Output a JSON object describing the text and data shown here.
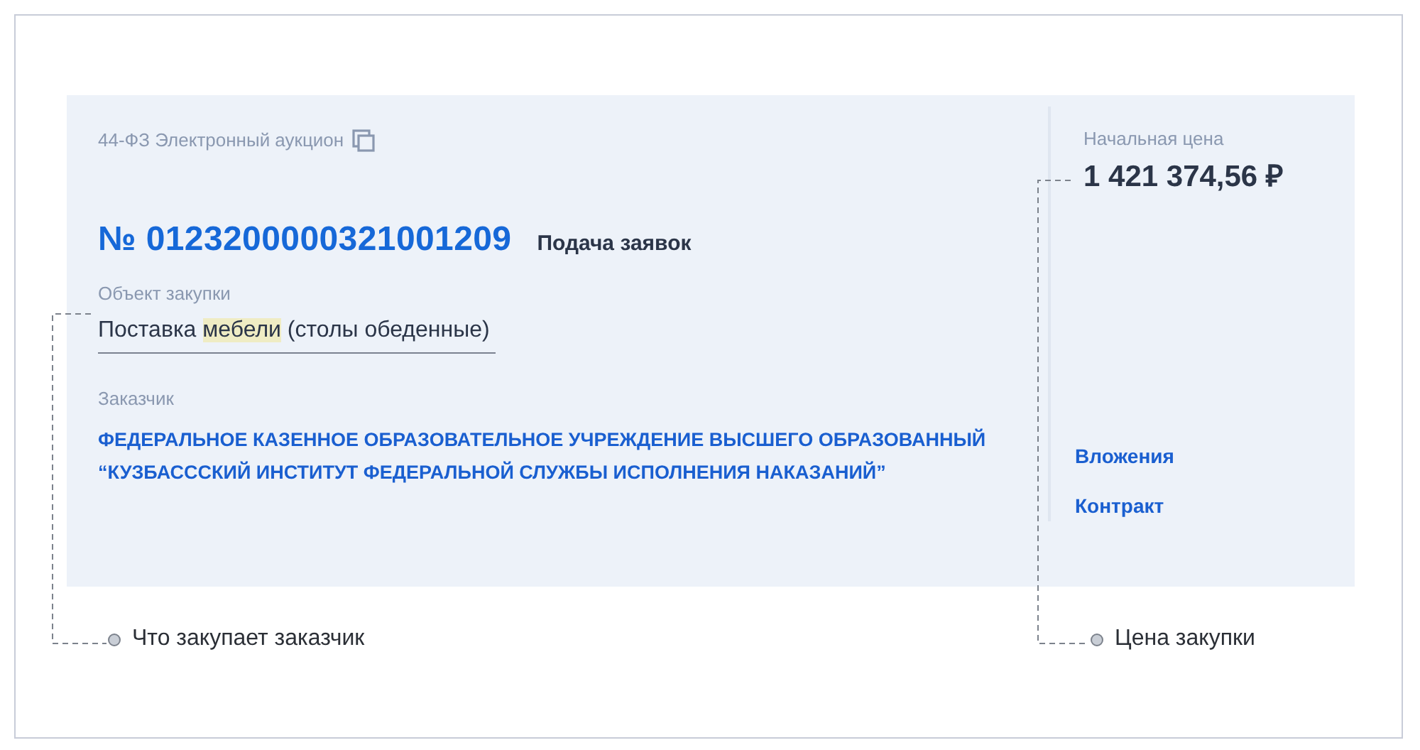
{
  "procedure": {
    "law_type": "44-ФЗ Электронный аукцион",
    "number": "№ 0123200000321001209",
    "status": "Подача заявок",
    "subject_label": "Объект закупки",
    "subject": [
      {
        "text": "Поставка ",
        "highlighted": false
      },
      {
        "text": "мебели",
        "highlighted": true
      },
      {
        "text": " (столы обеденные)",
        "highlighted": false
      }
    ],
    "customer_label": "Заказчик",
    "customer": "ФЕДЕРАЛЬНОЕ КАЗЕННОЕ ОБРАЗОВАТЕЛЬНОЕ УЧРЕЖДЕНИЕ ВЫСШЕГО ОБРАЗОВАННЫЙ “КУЗБАССCКИЙ ИНСТИТУТ ФЕДЕРАЛЬНОЙ СЛУЖБЫ ИСПОЛНЕНИЯ НАКАЗАНИЙ”",
    "price_label": "Начальная цена",
    "price": "1 421 374,56 ₽",
    "links": [
      "Вложения",
      "Контракт"
    ]
  },
  "annotations": [
    "Что закупает заказчик",
    "Цена закупки"
  ]
}
